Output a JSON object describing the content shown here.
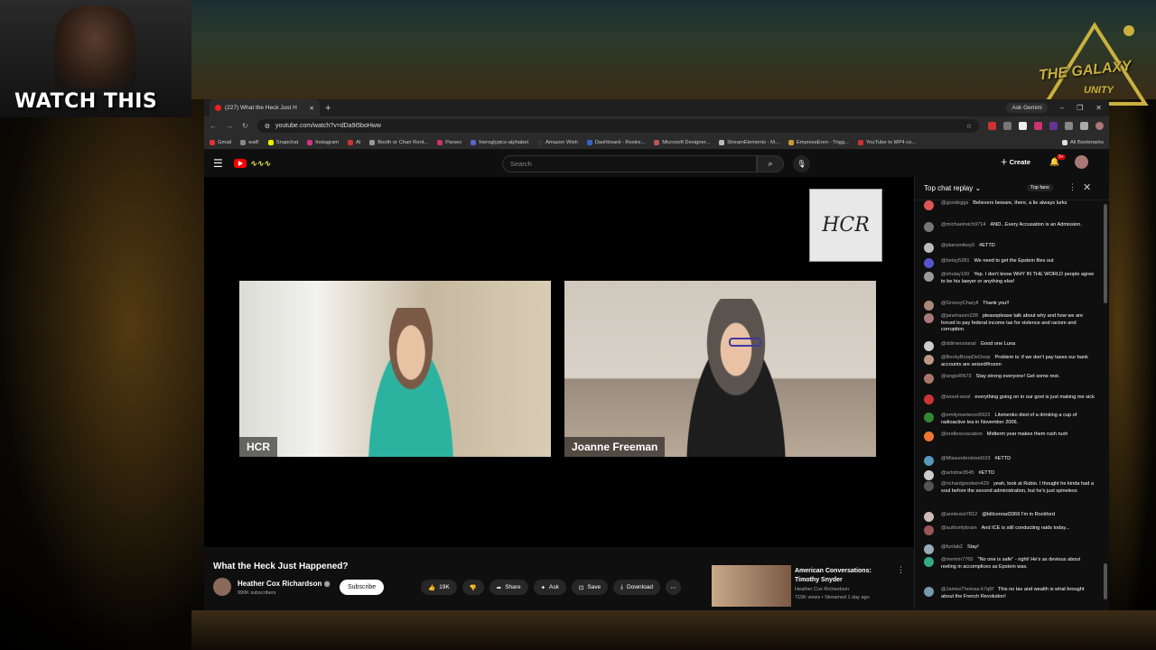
{
  "overlay": {
    "watch_text": "WATCH THIS",
    "galaxy_text": "THE GALAXY",
    "galaxy_sub": "UNITY"
  },
  "browser": {
    "tab_title": "(227) What the Heck Just H",
    "new_tab": "+",
    "ask_gemini": "Ask Gemini",
    "url": "youtube.com/watch?v=dDa9i5boHww",
    "bookmarks": [
      "Gmail",
      "wall!",
      "Snapchat",
      "Instagram",
      "Al",
      "Booth or Chair Rent...",
      "Parsec",
      "hieroglypics-alphabet",
      "Amazon Wish",
      "Dashboard - Restre...",
      "Microsoft Designer...",
      "StreamElements - M...",
      "EmpressEren - Trigg...",
      "YouTube to MP4 co...",
      "All Bookmarks"
    ],
    "bookmark_colors": [
      "#d33",
      "#888",
      "#ee0",
      "#c38",
      "#c33",
      "#999",
      "#c36",
      "#56c",
      "#333",
      "#36c",
      "#b55",
      "#bbb",
      "#c93",
      "#c33",
      "#ddd"
    ]
  },
  "youtube": {
    "search_placeholder": "Search",
    "create_label": "Create",
    "notif_count": "9+",
    "video": {
      "logo_text": "HCR",
      "cam1_label": "HCR",
      "cam2_label": "Joanne Freeman"
    },
    "title": "What the Heck Just Happened?",
    "channel_name": "Heather Cox Richardson",
    "subscribers": "990K subscribers",
    "subscribe_label": "Subscribe",
    "likes": "19K",
    "share_label": "Share",
    "ask_label": "Ask",
    "save_label": "Save",
    "download_label": "Download",
    "recommended": {
      "title": "American Conversations: Timothy Snyder",
      "channel": "Heather Cox Richardson",
      "meta": "715K views • Streamed 1 day ago"
    }
  },
  "chat": {
    "header": "Top chat replay",
    "top_fans": "Top fans",
    "messages": [
      {
        "user": "@goodeggs",
        "text": "Believers beware, there, a lie always lurks",
        "color": "#d55"
      },
      {
        "user": "@michaelreich9714",
        "text": "AND...Every Accusation is an Admission.",
        "color": "#777"
      },
      {
        "user": "@planomikey0",
        "text": "#ETTD",
        "color": "#bbb"
      },
      {
        "user": "@betsy5281",
        "text": "We need to get the Epstein files out",
        "color": "#55c"
      },
      {
        "user": "@shulay100",
        "text": "Yep. I don't know WHY IN THE WORLD people agree to be his lawyer or anything else!",
        "color": "#999"
      },
      {
        "user": "@GroovyCharyll",
        "text": "Thank you!!",
        "color": "#a87"
      },
      {
        "user": "@janehazen228",
        "text": "pleaseplease talk about why and how we are forced to pay federal income tax for violence and racism and corruption.",
        "color": "#a77"
      },
      {
        "user": "@ddimensional",
        "text": "Good one Luna",
        "color": "#ccc"
      },
      {
        "user": "@BeckyBoopDeDoop",
        "text": "Problem is: if we don't pay taxes our bank accounts are seized/frozen",
        "color": "#b98"
      },
      {
        "user": "@angieRN73",
        "text": "Stay strong everyone! Get some rest.",
        "color": "#a76"
      },
      {
        "user": "@wood-wool",
        "text": "everything going on in our govt is just making me sick",
        "color": "#c33"
      },
      {
        "user": "@emilymartenzo5922",
        "text": "Litvinenko died of a drinking a cup of radioactive tea in November 2006.",
        "color": "#383"
      },
      {
        "user": "@endlessvacation",
        "text": "Midterm year makes them rush rush",
        "color": "#e73"
      },
      {
        "user": "@Missunderstood103",
        "text": "#ETTD",
        "color": "#59b"
      },
      {
        "user": "@artstine3545",
        "text": "#ETTD",
        "color": "#ccc"
      },
      {
        "user": "@richardgoodwin429",
        "text": "yeah, look at Rubio. I thought he kinda had a soul before the second administration, but he's just spineless",
        "color": "#555"
      },
      {
        "user": "@annlexist7812",
        "text": "@billconrad3369 I'm in Rockford",
        "color": "#cbb"
      },
      {
        "user": "@authoritybrain",
        "text": "And ICE is still conducting raids today...",
        "color": "#955"
      },
      {
        "user": "@funlab2",
        "text": "Stay!",
        "color": "#9ab"
      },
      {
        "user": "@merrim7765",
        "text": "\"No one is safe\" - right! He's as devious about reeling in accomplices as Epstein was.",
        "color": "#3a8"
      },
      {
        "user": "@JamesThomas-k7q6f",
        "text": "This no tax and wealth is what brought about the French Revolution!",
        "color": "#79a"
      }
    ]
  }
}
